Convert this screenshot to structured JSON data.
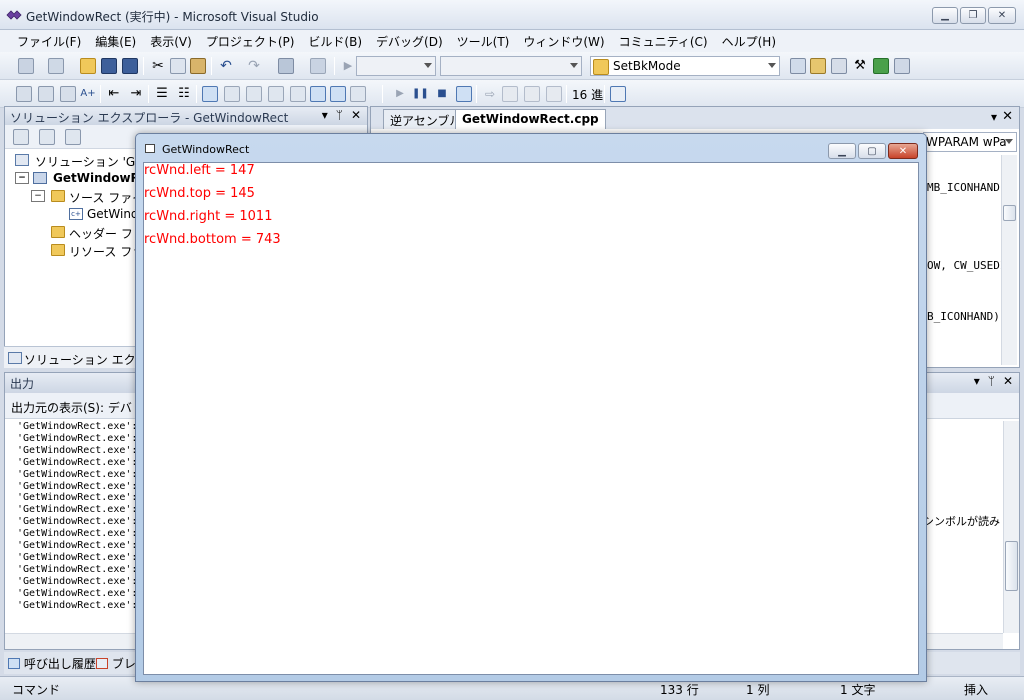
{
  "vs": {
    "title": "GetWindowRect (実行中) - Microsoft Visual Studio",
    "menu": [
      "ファイル(F)",
      "編集(E)",
      "表示(V)",
      "プロジェクト(P)",
      "ビルド(B)",
      "デバッグ(D)",
      "ツール(T)",
      "ウィンドウ(W)",
      "コミュニティ(C)",
      "ヘルプ(H)"
    ],
    "toolbar": {
      "find_combo": "SetBkMode",
      "hex_label": "16 進"
    },
    "solution_explorer": {
      "title": "ソリューション エクスプローラ - GetWindowRect",
      "items": [
        "ソリューション 'Get",
        "GetWindowRe",
        "ソース ファイ",
        "GetWindo",
        "ヘッダー フ",
        "リソース ファ"
      ],
      "bottom_tab": "ソリューション エクス"
    },
    "editor": {
      "tabs": [
        "逆アセンブル",
        "GetWindowRect.cpp"
      ],
      "member_combo": "WPARAM wPa",
      "code_fragments": [
        "MB_ICONHAND",
        "OW, CW_USEDI",
        "B_ICONHAND)"
      ]
    },
    "output": {
      "title": "出力",
      "source_label": "出力元の表示(S):",
      "source_value": "デバ",
      "lines": [
        "'GetWindowRect.exe':",
        "'GetWindowRect.exe':",
        "'GetWindowRect.exe':",
        "'GetWindowRect.exe':",
        "'GetWindowRect.exe':",
        "'GetWindowRect.exe':",
        "'GetWindowRect.exe':",
        "'GetWindowRect.exe':",
        "'GetWindowRect.exe':",
        "'GetWindowRect.exe':",
        "'GetWindowRect.exe':",
        "'GetWindowRect.exe':",
        "'GetWindowRect.exe':",
        "'GetWindowRect.exe':",
        "'GetWindowRect.exe':",
        "'GetWindowRect.exe':"
      ],
      "right_fragment": "シンボルが読み"
    },
    "bottom_tabs": [
      "呼び出し履歴",
      "ブレ"
    ],
    "status": {
      "left": "コマンド",
      "line": "133 行",
      "col": "1 列",
      "chars": "1 文字",
      "mode": "挿入"
    }
  },
  "child_window": {
    "title": "GetWindowRect",
    "lines": [
      "rcWnd.left = 147",
      "rcWnd.top = 145",
      "rcWnd.right = 1011",
      "rcWnd.bottom = 743"
    ],
    "text_color": "#ff0000"
  }
}
